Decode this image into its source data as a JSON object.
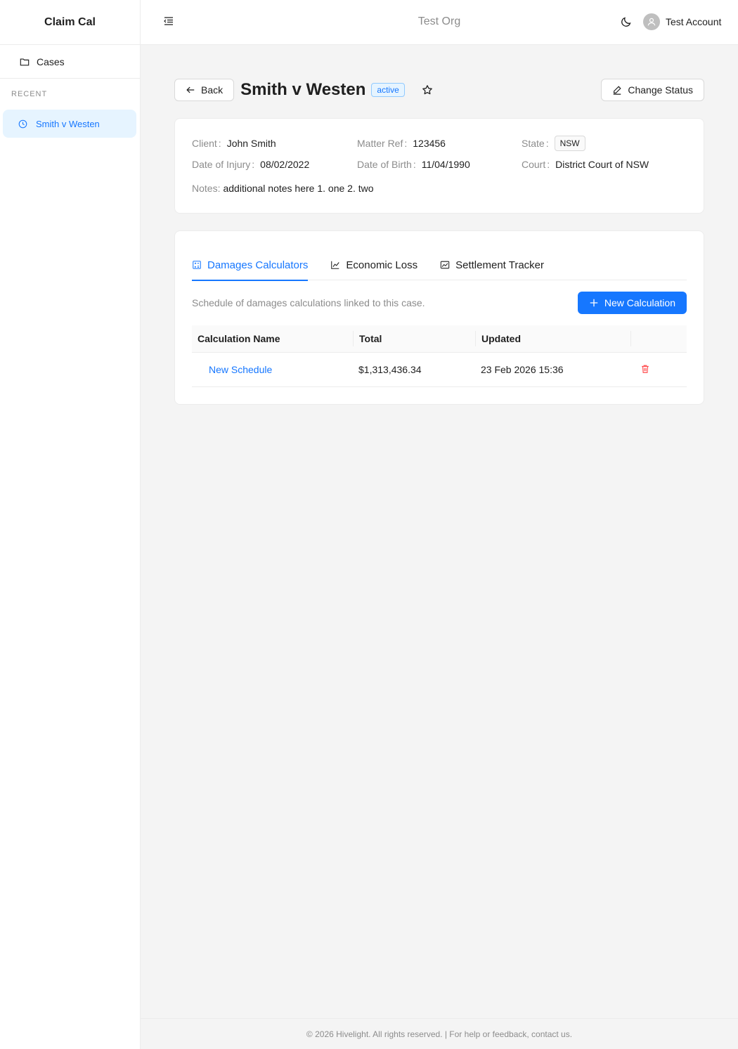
{
  "app": {
    "name": "Claim Cal"
  },
  "sidebar": {
    "cases_label": "Cases",
    "recent_label": "RECENT",
    "recent_items": [
      {
        "label": "Smith v Westen"
      }
    ]
  },
  "topbar": {
    "org": "Test Org",
    "account_name": "Test Account"
  },
  "case": {
    "back_label": "Back",
    "title": "Smith v Westen",
    "status": "active",
    "change_status_label": "Change Status",
    "fields": {
      "client_label": "Client",
      "client": "John Smith",
      "matter_ref_label": "Matter Ref",
      "matter_ref": "123456",
      "state_label": "State",
      "state": "NSW",
      "date_of_injury_label": "Date of Injury",
      "date_of_injury": "08/02/2022",
      "date_of_birth_label": "Date of Birth",
      "date_of_birth": "11/04/1990",
      "court_label": "Court",
      "court": "District Court of NSW",
      "notes_label": "Notes:",
      "notes": "additional notes here 1. one 2. two"
    }
  },
  "tabs": [
    {
      "label": "Damages Calculators",
      "active": true
    },
    {
      "label": "Economic Loss",
      "active": false
    },
    {
      "label": "Settlement Tracker",
      "active": false
    }
  ],
  "calculations": {
    "description": "Schedule of damages calculations linked to this case.",
    "new_label": "New Calculation",
    "columns": [
      "Calculation Name",
      "Total",
      "Updated"
    ],
    "rows": [
      {
        "name": "New Schedule",
        "total": "$1,313,436.34",
        "updated": "23 Feb 2026 15:36"
      }
    ]
  },
  "footer": {
    "text": "© 2026 Hivelight. All rights reserved. | For help or feedback, contact us."
  },
  "colors": {
    "primary": "#1677ff",
    "danger": "#ff4d4f",
    "active_bg": "#e6f4ff"
  }
}
